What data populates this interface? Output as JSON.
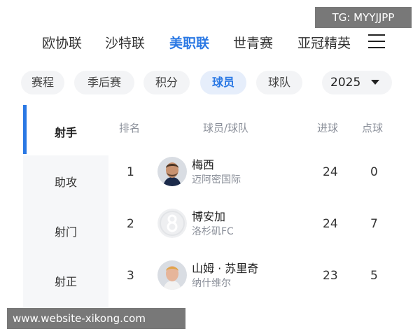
{
  "league_tabs": [
    {
      "label": "欧协联",
      "active": false
    },
    {
      "label": "沙特联",
      "active": false
    },
    {
      "label": "美职联",
      "active": true
    },
    {
      "label": "世青赛",
      "active": false
    },
    {
      "label": "亚冠精英",
      "active": false
    }
  ],
  "sub_tabs": [
    {
      "label": "赛程",
      "active": false
    },
    {
      "label": "季后赛",
      "active": false
    },
    {
      "label": "积分",
      "active": false
    },
    {
      "label": "球员",
      "active": true
    },
    {
      "label": "球队",
      "active": false
    }
  ],
  "season_select": {
    "value": "2025"
  },
  "side_nav": [
    {
      "label": "射手",
      "active": true
    },
    {
      "label": "助攻",
      "active": false
    },
    {
      "label": "射门",
      "active": false
    },
    {
      "label": "射正",
      "active": false
    }
  ],
  "table": {
    "headers": {
      "rank": "排名",
      "player": "球员/球队",
      "goals": "进球",
      "penalties": "点球"
    },
    "rows": [
      {
        "rank": "1",
        "name": "梅西",
        "team": "迈阿密国际",
        "goals": "24",
        "penalties": "0",
        "avatar": "player-photo"
      },
      {
        "rank": "2",
        "name": "博安加",
        "team": "洛杉矶FC",
        "goals": "24",
        "penalties": "7",
        "avatar": "placeholder-8"
      },
      {
        "rank": "3",
        "name": "山姆 · 苏里奇",
        "team": "纳什维尔",
        "goals": "23",
        "penalties": "5",
        "avatar": "player-photo"
      }
    ]
  },
  "watermark": {
    "top": "TG: MYYJJPP",
    "bottom": "www.website-xikong.com"
  },
  "colors": {
    "accent": "#2a78e4",
    "muted_text": "#8a8f99",
    "chip_bg": "#f3f4f6"
  }
}
